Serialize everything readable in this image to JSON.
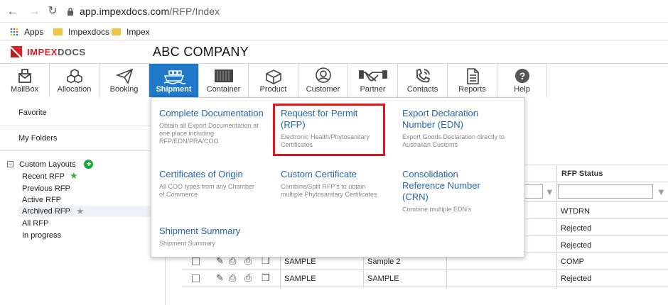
{
  "browser": {
    "url_host": "app.impexdocs.com",
    "url_path": "/RFP/Index",
    "bookmarks": [
      "Apps",
      "Impexdocs",
      "Impex"
    ]
  },
  "app": {
    "logo_text_a": "IMPEX",
    "logo_text_b": "DOCS",
    "company": "ABC COMPANY"
  },
  "modules": [
    {
      "label": "MailBox",
      "icon": "mailbox-icon"
    },
    {
      "label": "Allocation",
      "icon": "boxes-icon"
    },
    {
      "label": "Booking",
      "icon": "paper-plane-icon"
    },
    {
      "label": "Shipment",
      "icon": "ship-icon",
      "active": true
    },
    {
      "label": "Container",
      "icon": "container-icon"
    },
    {
      "label": "Product",
      "icon": "product-box-icon"
    },
    {
      "label": "Customer",
      "icon": "person-icon"
    },
    {
      "label": "Partner",
      "icon": "handshake-icon"
    },
    {
      "label": "Contacts",
      "icon": "phone-icon"
    },
    {
      "label": "Reports",
      "icon": "report-icon"
    },
    {
      "label": "Help",
      "icon": "help-icon"
    }
  ],
  "sidebar": {
    "favorite": "Favorite",
    "my_folders": "My Folders",
    "custom_layouts": "Custom Layouts",
    "layouts": [
      "Recent RFP",
      "Previous RFP",
      "Active RFP",
      "Archived RFP",
      "All RFP",
      "In progress"
    ]
  },
  "menu": {
    "complete_doc": {
      "title": "Complete Documentation",
      "desc": "Obtain all Export Documentation at one place including RFP/EDN/PRA/COO"
    },
    "rfp": {
      "title": "Request for Permit (RFP)",
      "desc": "Electronic Health/Phytosanitary Certificates"
    },
    "edn": {
      "title": "Export Declaration Number (EDN)",
      "desc": "Export Goods Declaration directly to Australian Customs"
    },
    "coo": {
      "title": "Certificates of Origin",
      "desc": "All COO types from any Chamber of Commerce"
    },
    "custom_cert": {
      "title": "Custom Certificate",
      "desc": "Combine/Split RFP's to obtain multiple Phytosanitary Certificates"
    },
    "crn": {
      "title": "Consolidation Reference Number (CRN)",
      "desc": "Combine multiple EDN's"
    },
    "summary": {
      "title": "Shipment Summary",
      "desc": "Shipment Summary"
    }
  },
  "grid": {
    "status_header": "RFP Status",
    "statuses": [
      "WTDRN",
      "Rejected",
      "Rejected",
      "COMP",
      "Rejected"
    ],
    "rows": [
      {
        "a": "SAMPLE",
        "b": "Sample 2"
      },
      {
        "a": "SAMPLE",
        "b": "SAMPLE"
      }
    ]
  }
}
